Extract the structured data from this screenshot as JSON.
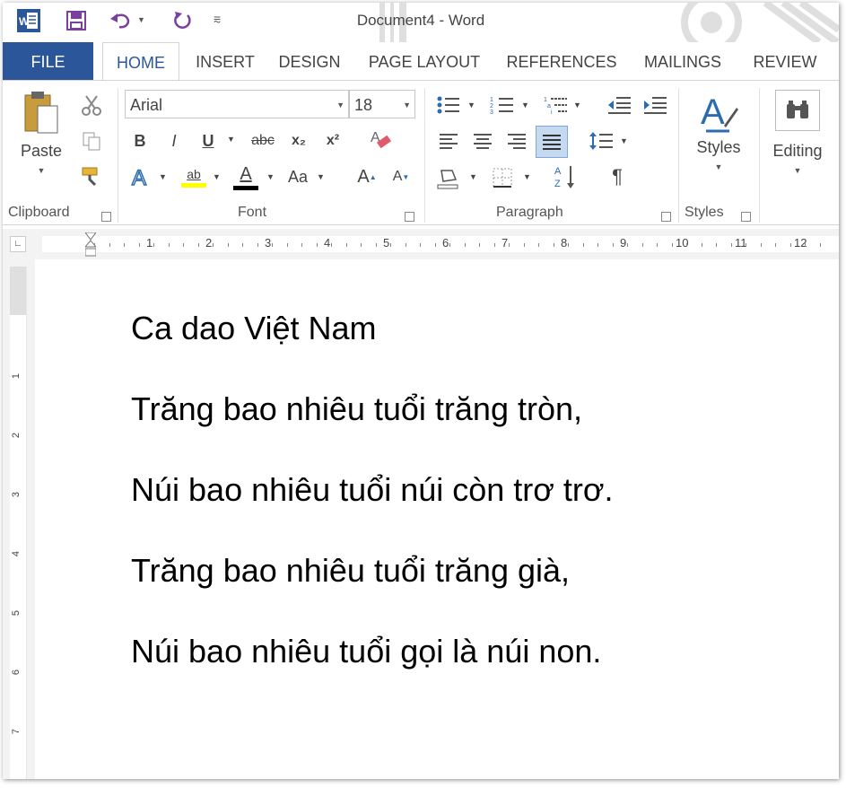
{
  "title": "Document4 - Word",
  "tabs": [
    "FILE",
    "HOME",
    "INSERT",
    "DESIGN",
    "PAGE LAYOUT",
    "REFERENCES",
    "MAILINGS",
    "REVIEW"
  ],
  "ribbon": {
    "paste_label": "Paste",
    "font_name": "Arial",
    "font_size": "18",
    "styles_label": "Styles",
    "editing_label": "Editing",
    "groups": [
      "Clipboard",
      "Font",
      "Paragraph",
      "Styles"
    ],
    "font_buttons": [
      "B",
      "I",
      "U",
      "abc",
      "x₂",
      "x²"
    ],
    "grow_font": "A",
    "shrink_font": "A",
    "change_case": "Aa",
    "highlight_text": "ab",
    "font_color_letter": "A",
    "pilcrow": "¶"
  },
  "ruler": {
    "numbers": [
      "1",
      "2",
      "3",
      "4",
      "5",
      "6",
      "7",
      "8",
      "9",
      "10",
      "11",
      "12"
    ],
    "vnumbers": [
      "1",
      "2",
      "3",
      "4",
      "5",
      "6",
      "7"
    ]
  },
  "document": {
    "lines": [
      "Ca dao Việt Nam",
      "Trăng bao nhiêu tuổi trăng tròn,",
      "Núi bao nhiêu tuổi núi còn trơ trơ.",
      "Trăng bao nhiêu tuổi trăng già,",
      "Núi bao nhiêu tuổi gọi là núi non."
    ]
  },
  "colors": {
    "accent": "#2b579a",
    "word_icon": "#2b579a",
    "quick_access": "#7b3f9f",
    "styles_icon": "#2b6cb0",
    "highlight": "#ffff00",
    "font_color": "#000000"
  }
}
